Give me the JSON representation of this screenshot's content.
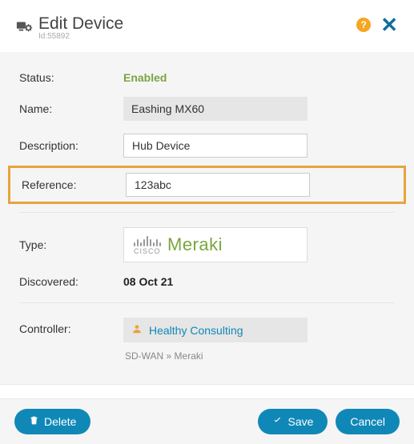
{
  "header": {
    "title": "Edit Device",
    "id_label": "Id:55892"
  },
  "form": {
    "status_label": "Status:",
    "status_value": "Enabled",
    "name_label": "Name:",
    "name_value": "Eashing MX60",
    "description_label": "Description:",
    "description_value": "Hub Device",
    "reference_label": "Reference:",
    "reference_value": "123abc",
    "type_label": "Type:",
    "type_brand_small": "CISCO",
    "type_brand_main": "Meraki",
    "discovered_label": "Discovered:",
    "discovered_value": "08 Oct 21",
    "controller_label": "Controller:",
    "controller_value": "Healthy Consulting",
    "breadcrumb": "SD-WAN » Meraki"
  },
  "footer": {
    "delete_label": "Delete",
    "save_label": "Save",
    "cancel_label": "Cancel"
  }
}
